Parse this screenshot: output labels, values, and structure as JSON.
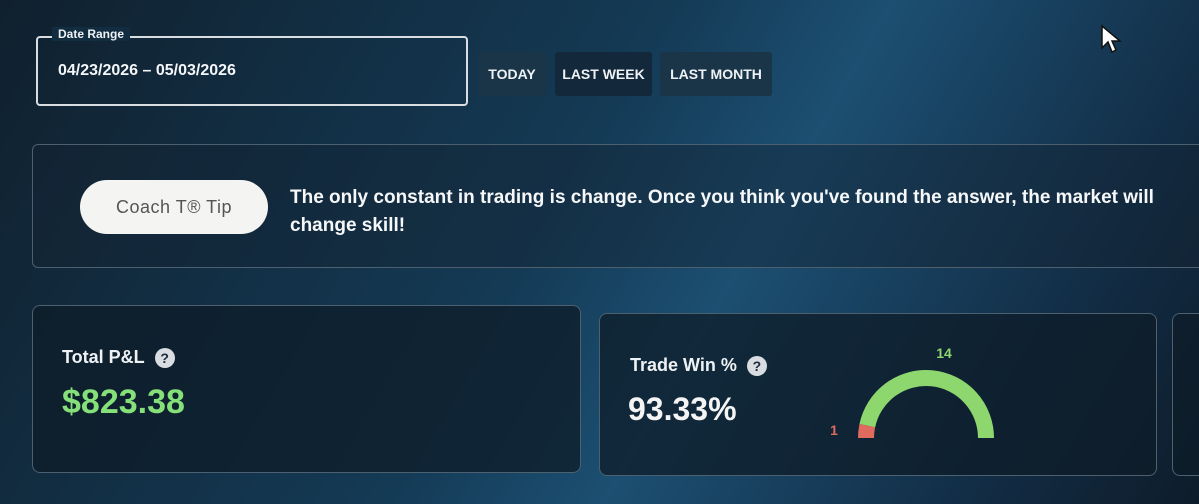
{
  "date_range": {
    "legend": "Date Range",
    "value": "04/23/2026 – 05/03/2026",
    "presets": [
      {
        "label": "TODAY",
        "active": false
      },
      {
        "label": "LAST WEEK",
        "active": true
      },
      {
        "label": "LAST MONTH",
        "active": false
      }
    ]
  },
  "coach_tip": {
    "button_label": "Coach T® Tip",
    "text": "The only constant in trading is change. Once you think you've found the answer, the market will change skill!"
  },
  "stats": {
    "total_pl": {
      "label": "Total P&L",
      "help": "?",
      "value": "$823.38",
      "color": "#86e07a"
    },
    "trade_win": {
      "label": "Trade Win %",
      "help": "?",
      "value": "93.33%",
      "gauge": {
        "wins": 14,
        "losses": 1,
        "win_label": "14",
        "loss_label": "1",
        "win_color": "#8ed66e",
        "loss_color": "#e06a5e"
      }
    }
  }
}
